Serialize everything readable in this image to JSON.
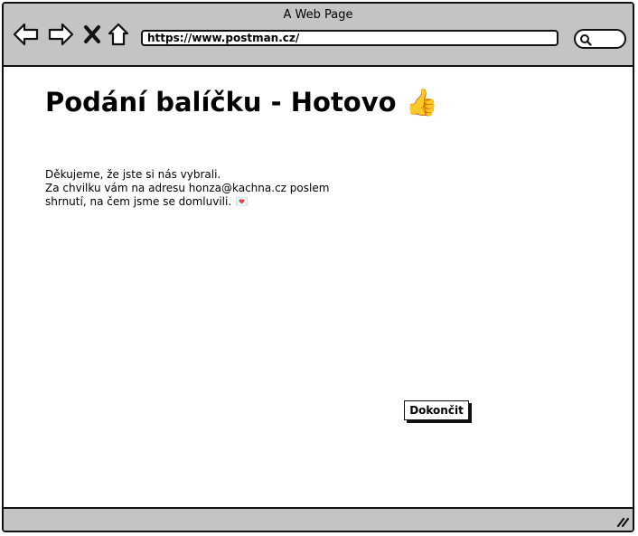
{
  "browser": {
    "window_title": "A Web Page",
    "url": "https://www.postman.cz/"
  },
  "page": {
    "title": "Podání balíčku - Hotovo",
    "title_emoji": "👍",
    "message_lines": [
      "Děkujeme, že jste si nás vybrali.",
      "Za chvilku vám na adresu honza@kachna.cz poslem",
      "shrnutí, na čem jsme se domluvili. 💌"
    ],
    "finish_button_label": "Dokončit"
  },
  "icons": {
    "back": "back-arrow-icon",
    "forward": "forward-arrow-icon",
    "stop": "close-icon",
    "home": "home-icon",
    "search": "search-icon",
    "resize": "resize-grip-icon"
  },
  "colors": {
    "chrome": "#c4c4c4",
    "border": "#111111",
    "background": "#ffffff"
  }
}
